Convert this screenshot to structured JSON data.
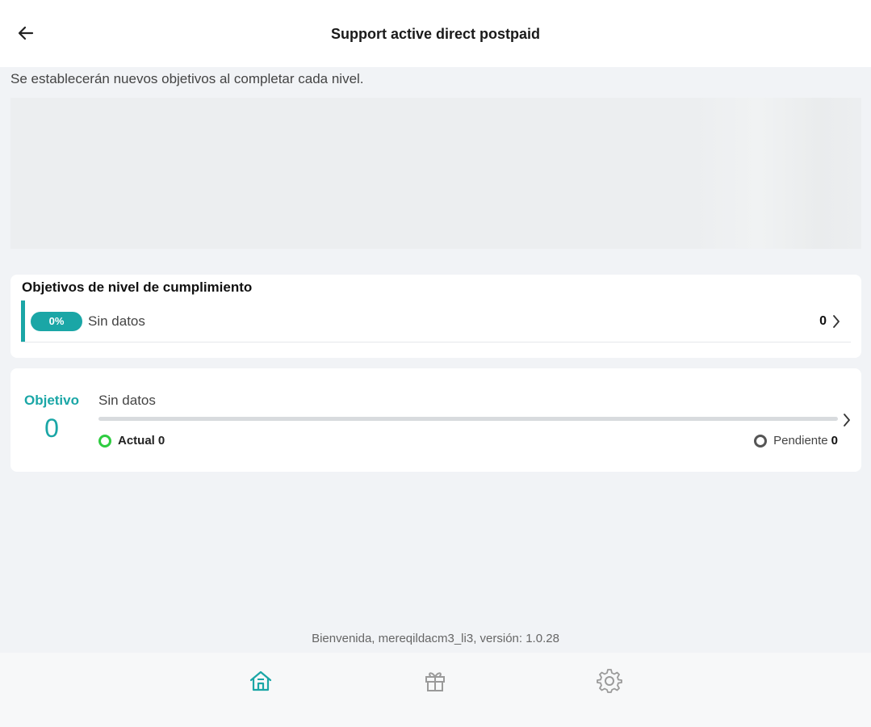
{
  "header": {
    "title": "Support active direct postpaid",
    "back_icon": "arrow-left-icon"
  },
  "intro": {
    "text": "Se establecerán nuevos objetivos al completar cada nivel."
  },
  "levels": {
    "title": "Objetivos de nivel de cumplimiento",
    "row": {
      "percent": "0%",
      "progress": 0,
      "label": "Sin datos",
      "count": "0"
    }
  },
  "goal": {
    "label": "Objetivo",
    "value": "0",
    "status": "Sin datos",
    "progress": 0,
    "actual_label": "Actual",
    "actual_value": "0",
    "pending_label": "Pendiente",
    "pending_value": "0"
  },
  "footer": {
    "text": "Bienvenida, mereqildacm3_li3, versión: 1.0.28"
  },
  "nav": {
    "items": [
      {
        "icon": "home-icon",
        "active": true
      },
      {
        "icon": "gift-icon",
        "active": false
      },
      {
        "icon": "gear-icon",
        "active": false
      }
    ]
  },
  "colors": {
    "accent": "#1aa6a6",
    "actual": "#2ecc40",
    "pending": "#555555",
    "inactive_icon": "#9a9a9a"
  }
}
